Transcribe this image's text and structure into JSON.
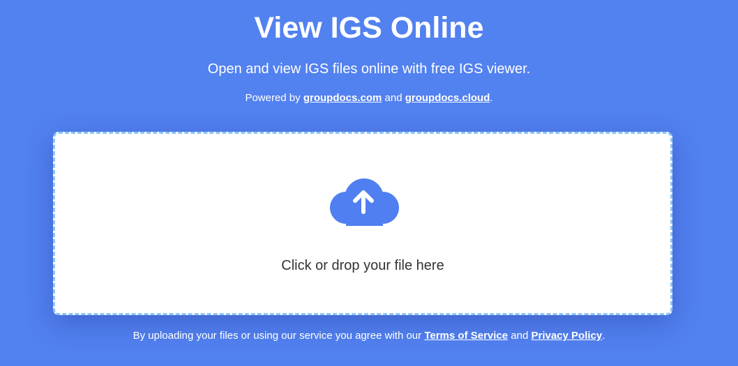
{
  "header": {
    "title": "View IGS Online",
    "subtitle": "Open and view IGS files online with free IGS viewer.",
    "powered_prefix": "Powered by ",
    "powered_link1": "groupdocs.com",
    "powered_mid": " and ",
    "powered_link2": "groupdocs.cloud",
    "powered_suffix": "."
  },
  "dropzone": {
    "icon": "cloud-upload-icon",
    "text": "Click or drop your file here"
  },
  "footer": {
    "legal_prefix": "By uploading your files or using our service you agree with our ",
    "terms_link": "Terms of Service",
    "legal_mid": " and ",
    "privacy_link": "Privacy Policy",
    "legal_suffix": "."
  },
  "colors": {
    "background": "#5281f0",
    "accent": "#4f7ff0",
    "dropzone_border": "#8ec6f2",
    "text": "#ffffff"
  }
}
